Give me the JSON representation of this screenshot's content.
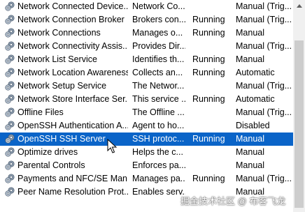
{
  "services": [
    {
      "name": "Network Connected Device...",
      "description": "Network Co...",
      "status": "",
      "startup": "Manual (Trig..."
    },
    {
      "name": "Network Connection Broker",
      "description": "Brokers con...",
      "status": "Running",
      "startup": "Manual (Trig..."
    },
    {
      "name": "Network Connections",
      "description": "Manages o...",
      "status": "Running",
      "startup": "Manual"
    },
    {
      "name": "Network Connectivity Assis...",
      "description": "Provides Dir...",
      "status": "",
      "startup": "Manual (Trig..."
    },
    {
      "name": "Network List Service",
      "description": "Identifies th...",
      "status": "Running",
      "startup": "Manual"
    },
    {
      "name": "Network Location Awareness",
      "description": "Collects an...",
      "status": "Running",
      "startup": "Automatic"
    },
    {
      "name": "Network Setup Service",
      "description": "The Networ...",
      "status": "",
      "startup": "Manual (Trig..."
    },
    {
      "name": "Network Store Interface Ser...",
      "description": "This service ...",
      "status": "Running",
      "startup": "Automatic"
    },
    {
      "name": "Offline Files",
      "description": "The Offline ...",
      "status": "",
      "startup": "Manual (Trig..."
    },
    {
      "name": "OpenSSH Authentication A...",
      "description": "Agent to ho...",
      "status": "",
      "startup": "Disabled"
    },
    {
      "name": "OpenSSH SSH Server",
      "description": "SSH protoc...",
      "status": "Running",
      "startup": "Manual"
    },
    {
      "name": "Optimize drives",
      "description": "Helps the c...",
      "status": "",
      "startup": "Manual"
    },
    {
      "name": "Parental Controls",
      "description": "Enforces pa...",
      "status": "",
      "startup": "Manual"
    },
    {
      "name": "Payments and NFC/SE Man...",
      "description": "Manages pa...",
      "status": "Running",
      "startup": "Manual (Trig..."
    },
    {
      "name": "Peer Name Resolution Prot...",
      "description": "Enables serv...",
      "status": "",
      "startup": "Manual"
    }
  ],
  "selected_service": "OpenSSH SSH Server",
  "row_icon": "service-gear-icon",
  "colors": {
    "selection": "#0a64c8",
    "scrollbar_track": "#f0f0f0",
    "scrollbar_thumb": "#cdcdcd"
  },
  "watermark": "掘金技术社区 @ 布客飞龙"
}
